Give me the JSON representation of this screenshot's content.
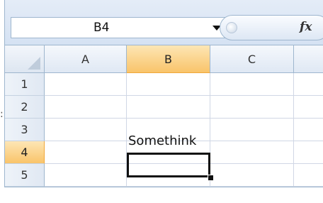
{
  "name_box": {
    "value": "B4"
  },
  "formula_bar": {
    "fx_label": "fx"
  },
  "columns": [
    {
      "label": "A",
      "selected": false
    },
    {
      "label": "B",
      "selected": true
    },
    {
      "label": "C",
      "selected": false
    }
  ],
  "rows": [
    {
      "label": "1",
      "selected": false
    },
    {
      "label": "2",
      "selected": false
    },
    {
      "label": "3",
      "selected": false
    },
    {
      "label": "4",
      "selected": true
    },
    {
      "label": "5",
      "selected": false
    }
  ],
  "cells": {
    "B3": "Somethink",
    "B4": ""
  },
  "active_cell": "B4",
  "colors": {
    "header_active": "#f9c46a",
    "header_border": "#9eb6ce",
    "gridline": "#d0d7e5",
    "selection_border": "#111111"
  },
  "icons": {
    "cancel": "cancel-icon",
    "function": "fx-icon",
    "dropdown": "chevron-down-icon"
  }
}
